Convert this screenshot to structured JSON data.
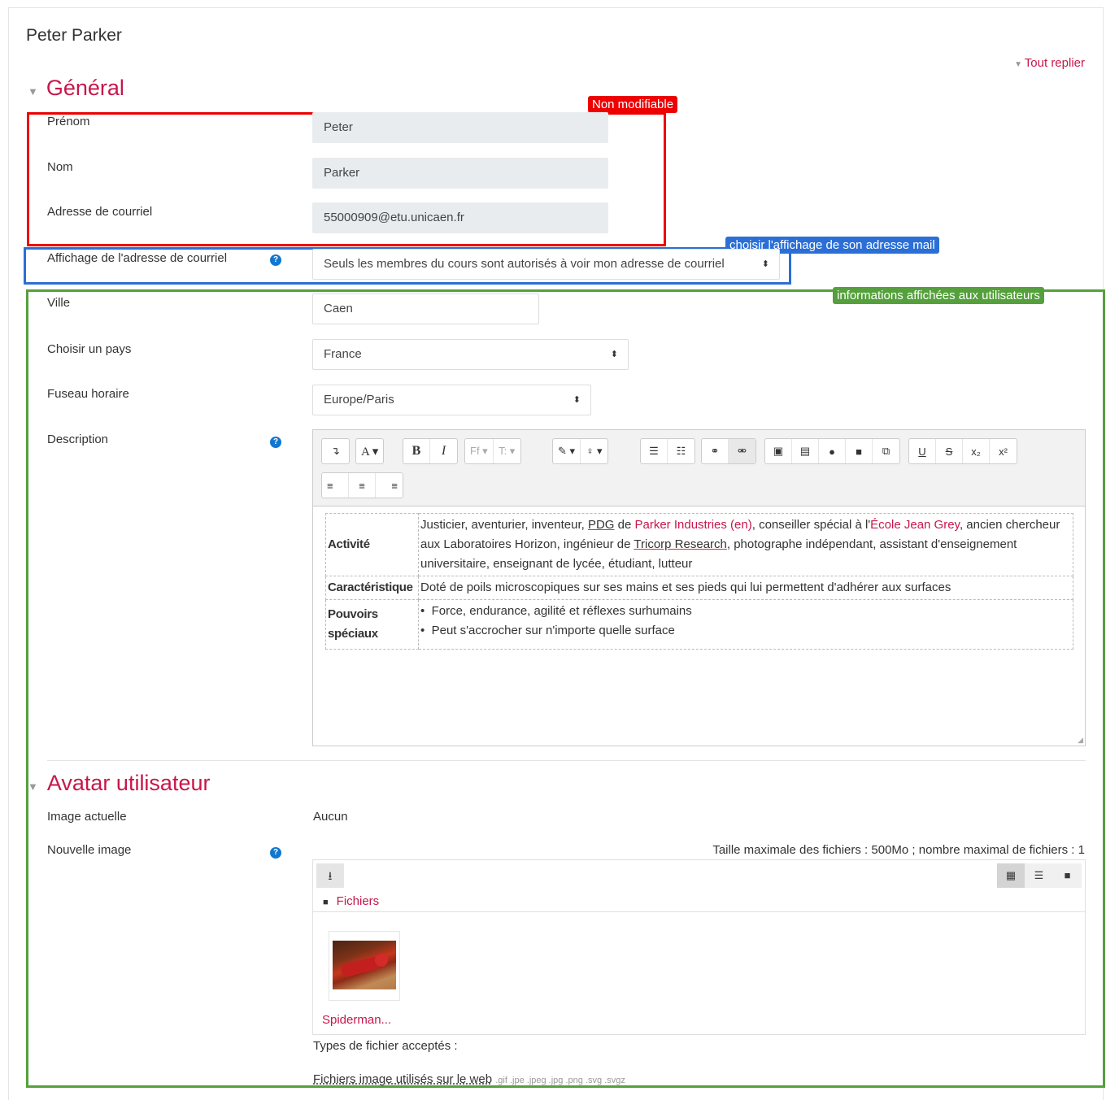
{
  "page": {
    "title": "Peter Parker",
    "collapse_all": "Tout replier"
  },
  "general": {
    "title": "Général",
    "prenom": {
      "label": "Prénom",
      "value": "Peter"
    },
    "nom": {
      "label": "Nom",
      "value": "Parker"
    },
    "email": {
      "label": "Adresse de courriel",
      "value": "55000909@etu.unicaen.fr"
    },
    "email_display": {
      "label": "Affichage de l'adresse de courriel",
      "value": "Seuls les membres du cours sont autorisés à voir mon adresse de courriel"
    },
    "ville": {
      "label": "Ville",
      "value": "Caen"
    },
    "pays": {
      "label": "Choisir un pays",
      "value": "France"
    },
    "fuseau": {
      "label": "Fuseau horaire",
      "value": "Europe/Paris"
    },
    "description": {
      "label": "Description"
    }
  },
  "annotations": {
    "non_modifiable": "Non modifiable",
    "email_choice": "choisir l'affichage de son adresse mail",
    "public_info": "informations affichées aux utilisateurs"
  },
  "editor": {
    "buttons": [
      "↴",
      "A ▾",
      "B",
      "I",
      "Ff ▾",
      "T: ▾",
      "✎ ▾",
      "♀ ▾",
      "☰",
      "☷",
      "⚭",
      "⚮",
      "▣",
      "▤",
      "●",
      "■",
      "⧉",
      "U",
      "S",
      "x₂",
      "x²",
      "≡",
      "≡",
      "≡"
    ],
    "rows": {
      "activite": {
        "label": "Activité",
        "t1": "Justicier, aventurier, inventeur, ",
        "pdg": "PDG",
        "t2": " de ",
        "link1": "Parker Industries (en)",
        "t3": ", conseiller spécial à l'",
        "link2": "École Jean Grey",
        "t4": ", ancien chercheur aux Laboratoires Horizon, ingénieur de ",
        "tricorp": "Tricorp Research",
        "t5": ", photographe indépendant, assistant d'enseignement universitaire, enseignant de lycée, étudiant, lutteur"
      },
      "caracteristique": {
        "label": "Caractéristique",
        "text": "Doté de poils microscopiques sur ses mains et ses pieds qui lui permettent d'adhérer aux surfaces"
      },
      "pouvoirs": {
        "label": "Pouvoirs spéciaux",
        "items": [
          "Force, endurance, agilité et réflexes surhumains",
          "Peut s'accrocher sur n'importe quelle surface"
        ]
      }
    }
  },
  "avatar": {
    "title": "Avatar utilisateur",
    "current": {
      "label": "Image actuelle",
      "value": "Aucun"
    },
    "new": {
      "label": "Nouvelle image"
    },
    "max_info": "Taille maximale des fichiers : 500Mo ; nombre maximal de fichiers : 1",
    "folder": "Fichiers",
    "file_name": "Spiderman...",
    "accepted_label": "Types de fichier acceptés :",
    "web_images": "Fichiers image utilisés sur le web",
    "extensions": ".gif .jpe .jpeg .jpg .png .svg .svgz"
  }
}
